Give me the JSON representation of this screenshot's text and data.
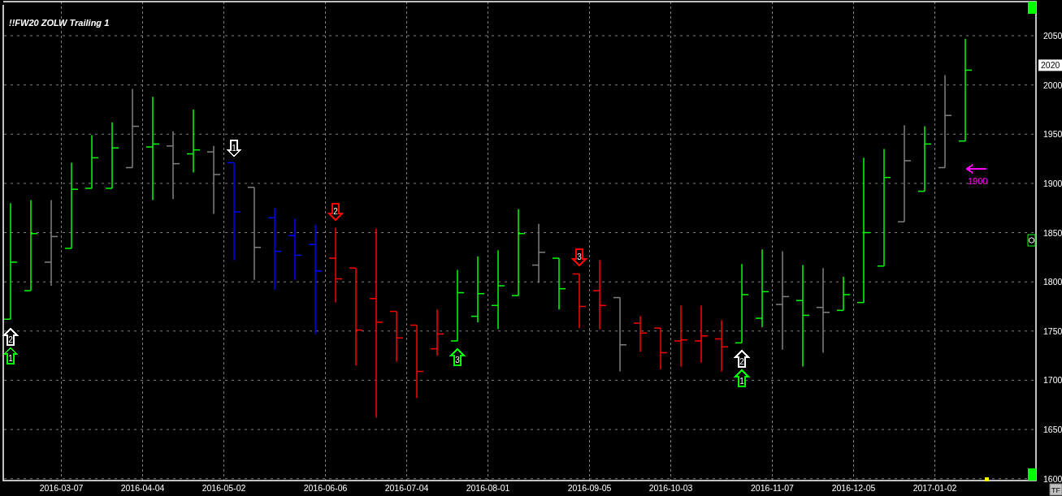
{
  "chart_title": "!!FW20 ZOLW Trailing 1",
  "y_axis_labels": [
    "2050",
    "2000",
    "1950",
    "1900",
    "1850",
    "1800",
    "1750",
    "1700",
    "1650",
    "1600"
  ],
  "x_axis_labels": [
    "2016-03-07",
    "2016-04-04",
    "2016-05-02",
    "2016-06-06",
    "2016-07-04",
    "2016-08-01",
    "2016-09-05",
    "2016-10-03",
    "2016-11-07",
    "2016-12-05",
    "2017-01-02"
  ],
  "price_label": "2020",
  "signals": [
    {
      "kind": "arrow-down",
      "text": "1",
      "color": "#ffffff"
    },
    {
      "kind": "arrow-down",
      "text": "2",
      "color": "#ff0000"
    },
    {
      "kind": "arrow-down",
      "text": "3",
      "color": "#ff0000"
    },
    {
      "kind": "arrow-up",
      "text": "2",
      "color": "#ffffff"
    },
    {
      "kind": "arrow-up",
      "text": "1",
      "color": "#00ff00"
    },
    {
      "kind": "arrow-up",
      "text": "3",
      "color": "#00ff00"
    },
    {
      "kind": "arrow-up",
      "text": "2",
      "color": "#ffffff"
    },
    {
      "kind": "arrow-up",
      "text": "1",
      "color": "#00ff00"
    }
  ],
  "price_alert": {
    "text": "1900",
    "color": "#ff00ff"
  },
  "tf_button": {
    "label": "TF"
  }
}
